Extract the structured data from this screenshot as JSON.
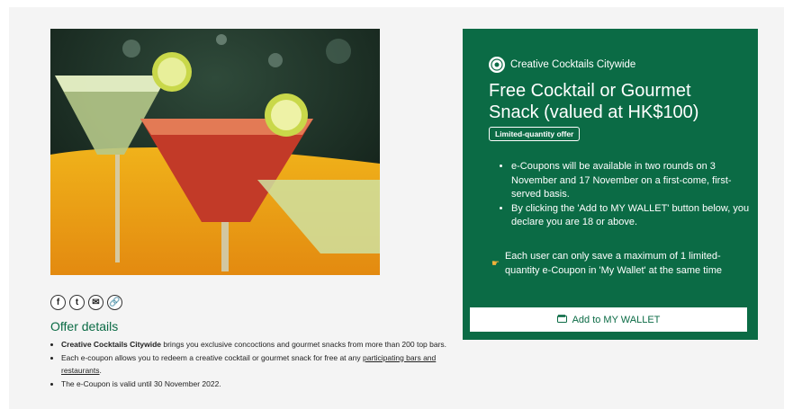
{
  "hero": {
    "alt": "Cocktails"
  },
  "share": {
    "facebook": "f",
    "twitter": "t",
    "email": "✉",
    "link": "🔗"
  },
  "offer": {
    "title": "Offer details",
    "item1_bold": "Creative Cocktails Citywide",
    "item1_text": " brings you exclusive concoctions and gourmet snacks from more than 200 top bars.",
    "item2_text": "Each e-coupon allows you to redeem a creative cocktail or gourmet snack for free at any ",
    "item2_link": "participating bars and restaurants",
    "item2_end": ".",
    "item3_text": "The e-Coupon is valid until 30 November 2022."
  },
  "panel": {
    "brand": "Creative Cocktails Citywide",
    "title": "Free Cocktail or Gourmet Snack (valued at HK$100)",
    "tag": "Limited-quantity offer",
    "bullet1": "e-Coupons will be available in two rounds on 3 November and 17 November on a first-come, first-served basis.",
    "bullet2": "By clicking the 'Add to MY WALLET' button below, you declare you are 18 or above.",
    "note": "Each user can only save a maximum of 1 limited-quantity e-Coupon in 'My Wallet' at the same time",
    "button": "Add to MY WALLET"
  },
  "colors": {
    "brand_green": "#0b6b45"
  }
}
